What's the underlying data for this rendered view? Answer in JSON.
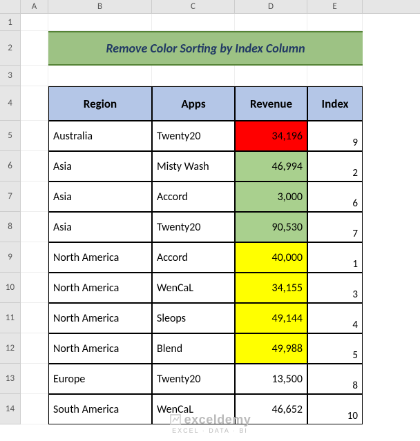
{
  "columns": [
    "A",
    "B",
    "C",
    "D",
    "E"
  ],
  "row_labels": [
    "1",
    "2",
    "3",
    "4",
    "5",
    "6",
    "7",
    "8",
    "9",
    "10",
    "11",
    "12",
    "13",
    "14"
  ],
  "title": "Remove Color Sorting by Index Column",
  "headers": {
    "region": "Region",
    "apps": "Apps",
    "revenue": "Revenue",
    "index": "Index"
  },
  "rows": [
    {
      "region": "Australia",
      "apps": "Twenty20",
      "revenue": "34,196",
      "index": "9",
      "fill": "fill-red"
    },
    {
      "region": "Asia",
      "apps": "Misty Wash",
      "revenue": "46,994",
      "index": "2",
      "fill": "fill-green"
    },
    {
      "region": "Asia",
      "apps": "Accord",
      "revenue": "3,000",
      "index": "6",
      "fill": "fill-green"
    },
    {
      "region": "Asia",
      "apps": "Twenty20",
      "revenue": "90,530",
      "index": "7",
      "fill": "fill-green"
    },
    {
      "region": "North America",
      "apps": "Accord",
      "revenue": "40,000",
      "index": "1",
      "fill": "fill-yellow"
    },
    {
      "region": "North America",
      "apps": "WenCaL",
      "revenue": "34,155",
      "index": "3",
      "fill": "fill-yellow"
    },
    {
      "region": "North America",
      "apps": "Sleops",
      "revenue": "49,144",
      "index": "4",
      "fill": "fill-yellow"
    },
    {
      "region": "North America",
      "apps": "Blend",
      "revenue": "49,988",
      "index": "5",
      "fill": "fill-yellow"
    },
    {
      "region": "Europe",
      "apps": "Twenty20",
      "revenue": "13,500",
      "index": "8",
      "fill": ""
    },
    {
      "region": "South America",
      "apps": "WenCaL",
      "revenue": "46,652",
      "index": "10",
      "fill": ""
    }
  ],
  "watermark": {
    "brand": "exceldemy",
    "sub": "EXCEL · DATA · BI"
  },
  "chart_data": {
    "type": "table",
    "title": "Remove Color Sorting by Index Column",
    "columns": [
      "Region",
      "Apps",
      "Revenue",
      "Index"
    ],
    "rows": [
      [
        "Australia",
        "Twenty20",
        34196,
        9
      ],
      [
        "Asia",
        "Misty Wash",
        46994,
        2
      ],
      [
        "Asia",
        "Accord",
        3000,
        6
      ],
      [
        "Asia",
        "Twenty20",
        90530,
        7
      ],
      [
        "North America",
        "Accord",
        40000,
        1
      ],
      [
        "North America",
        "WenCaL",
        34155,
        3
      ],
      [
        "North America",
        "Sleops",
        49144,
        4
      ],
      [
        "North America",
        "Blend",
        49988,
        5
      ],
      [
        "Europe",
        "Twenty20",
        13500,
        8
      ],
      [
        "South America",
        "WenCaL",
        46652,
        10
      ]
    ],
    "cell_fill_colors_revenue": [
      "red",
      "green",
      "green",
      "green",
      "yellow",
      "yellow",
      "yellow",
      "yellow",
      "none",
      "none"
    ]
  }
}
